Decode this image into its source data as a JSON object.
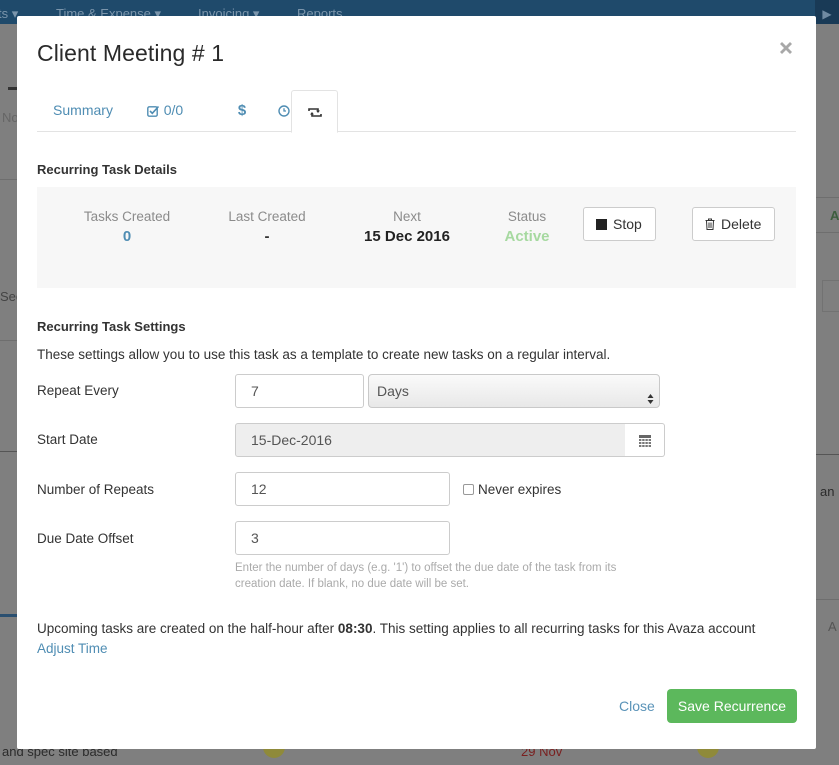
{
  "background": {
    "nav_items": [
      "ts ▾",
      "Time & Expense ▾",
      "Invoicing ▾",
      "Reports"
    ],
    "fragments": {
      "left_no": "No",
      "left_sec": "Sec",
      "right_a1": "A",
      "right_an": "an",
      "right_a2": "A",
      "bottom_task": "and spec site based",
      "bottom_date": "29 Nov"
    }
  },
  "modal": {
    "title": "Client Meeting # 1",
    "close_icon": "times-icon",
    "tabs": [
      {
        "label": "Summary",
        "icon": null,
        "active": false
      },
      {
        "label": "0/0",
        "icon": "checkbox-icon",
        "active": false
      },
      {
        "label": "",
        "icon": "dollar-icon",
        "active": false
      },
      {
        "label": "",
        "icon": "clock-icon",
        "active": false
      },
      {
        "label": "",
        "icon": "retweet-icon",
        "active": true
      }
    ],
    "details": {
      "heading": "Recurring Task Details",
      "tasks_created": {
        "label": "Tasks Created",
        "value": "0"
      },
      "last_created": {
        "label": "Last Created",
        "value": "-"
      },
      "next": {
        "label": "Next",
        "value": "15 Dec 2016"
      },
      "status": {
        "label": "Status",
        "value": "Active"
      },
      "stop_label": "Stop",
      "delete_label": "Delete"
    },
    "settings": {
      "heading": "Recurring Task Settings",
      "description": "These settings allow you to use this task as a template to create new tasks on a regular interval.",
      "repeat_every": {
        "label": "Repeat Every",
        "value": "7",
        "unit": "Days"
      },
      "start_date": {
        "label": "Start Date",
        "value": "15-Dec-2016"
      },
      "number_of_repeats": {
        "label": "Number of Repeats",
        "value": "12",
        "never_expires_label": "Never expires",
        "never_expires_checked": false
      },
      "due_date_offset": {
        "label": "Due Date Offset",
        "value": "3",
        "help": "Enter the number of days (e.g. '1') to offset the due date of the task from its creation date. If blank, no due date will be set."
      }
    },
    "upcoming": {
      "prefix": "Upcoming tasks are created on the half-hour after ",
      "time": "08:30",
      "suffix": ". This setting applies to all recurring tasks for this Avaza account",
      "link": "Adjust Time"
    },
    "footer": {
      "close_label": "Close",
      "save_label": "Save Recurrence"
    }
  },
  "colors": {
    "link": "#4f8db3",
    "active_status": "#a6d9a0",
    "save_button": "#5cb85c",
    "tasks_created_value": "#4f8db3"
  }
}
